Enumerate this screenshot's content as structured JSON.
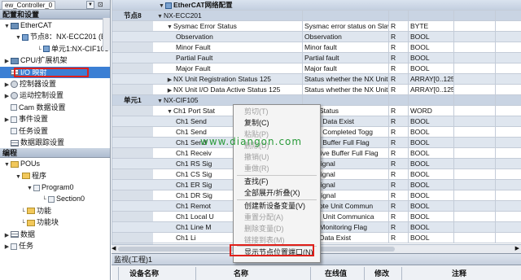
{
  "left": {
    "window_title": "ew_Controller_0",
    "section_config": "配置和设置",
    "section_program": "编程",
    "tree": [
      {
        "label": "EtherCAT"
      },
      {
        "label": "节点8：NX-ECC201 (E"
      },
      {
        "label": "单元1:NX-CIF105"
      },
      {
        "label": "CPU/扩展机架"
      },
      {
        "label": "I/O 映射"
      },
      {
        "label": "控制器设置"
      },
      {
        "label": "运动控制设置"
      },
      {
        "label": "Cam 数据设置"
      },
      {
        "label": "事件设置"
      },
      {
        "label": "任务设置"
      },
      {
        "label": "数据跟踪设置"
      }
    ],
    "program_tree": [
      {
        "label": "POUs"
      },
      {
        "label": "程序"
      },
      {
        "label": "Program0"
      },
      {
        "label": "Section0"
      },
      {
        "label": "功能"
      },
      {
        "label": "功能块"
      },
      {
        "label": "数据"
      },
      {
        "label": "任务"
      }
    ]
  },
  "grid": {
    "header": "EtherCAT网络配置",
    "rows": [
      {
        "node": "节点8",
        "name": "NX-ECC201",
        "desc": "",
        "rw": "",
        "type": ""
      },
      {
        "node": "",
        "name": "Sysmac Error Status",
        "desc": "Sysmac error status on Slav",
        "rw": "R",
        "type": "BYTE"
      },
      {
        "node": "",
        "name": "Observation",
        "desc": "Observation",
        "rw": "R",
        "type": "BOOL"
      },
      {
        "node": "",
        "name": "Minor Fault",
        "desc": "Minor fault",
        "rw": "R",
        "type": "BOOL"
      },
      {
        "node": "",
        "name": "Partial Fault",
        "desc": "Partial fault",
        "rw": "R",
        "type": "BOOL"
      },
      {
        "node": "",
        "name": "Major Fault",
        "desc": "Major fault",
        "rw": "R",
        "type": "BOOL"
      },
      {
        "node": "",
        "name": "NX Unit Registration Status 125",
        "desc": "Status whether the NX Unit",
        "rw": "R",
        "type": "ARRAY[0..125"
      },
      {
        "node": "",
        "name": "NX Unit I/O Data Active Status 125",
        "desc": "Status whether the NX Unit",
        "rw": "R",
        "type": "ARRAY[0..125"
      },
      {
        "node": "单元1",
        "name": "NX-CIF105",
        "desc": "",
        "rw": "",
        "type": ""
      },
      {
        "node": "",
        "name": "Ch1 Port Stat",
        "desc": "Port Status",
        "rw": "R",
        "type": "WORD"
      },
      {
        "node": "",
        "name": "Ch1 Send",
        "desc": "Send Data Exist",
        "rw": "R",
        "type": "BOOL"
      },
      {
        "node": "",
        "name": "Ch1 Send",
        "desc": "Send Completed Togg",
        "rw": "R",
        "type": "BOOL"
      },
      {
        "node": "",
        "name": "Ch1 Send",
        "desc": "Send Buffer Full Flag",
        "rw": "R",
        "type": "BOOL"
      },
      {
        "node": "",
        "name": "Ch1 Receiv",
        "desc": "Receive Buffer Full Flag",
        "rw": "R",
        "type": "BOOL"
      },
      {
        "node": "",
        "name": "Ch1 RS Sig",
        "desc": "RS Signal",
        "rw": "R",
        "type": "BOOL"
      },
      {
        "node": "",
        "name": "Ch1 CS Sig",
        "desc": "CS Signal",
        "rw": "R",
        "type": "BOOL"
      },
      {
        "node": "",
        "name": "Ch1 ER Sig",
        "desc": "ER Signal",
        "rw": "R",
        "type": "BOOL"
      },
      {
        "node": "",
        "name": "Ch1 DR Sig",
        "desc": "DR Signal",
        "rw": "R",
        "type": "BOOL"
      },
      {
        "node": "",
        "name": "Ch1 Remot",
        "desc": "Remote Unit Commun",
        "rw": "R",
        "type": "BOOL"
      },
      {
        "node": "",
        "name": "Ch1 Local U",
        "desc": "Local Unit Communica",
        "rw": "R",
        "type": "BOOL"
      },
      {
        "node": "",
        "name": "Ch1 Line M",
        "desc": "Line Monitoring Flag",
        "rw": "R",
        "type": "BOOL"
      },
      {
        "node": "",
        "name": "Ch1 Li",
        "desc": "Line Data Exist",
        "rw": "R",
        "type": "BOOL"
      }
    ]
  },
  "context_menu": {
    "items": [
      {
        "label": "剪切(T)",
        "enabled": false
      },
      {
        "label": "复制(C)",
        "enabled": true
      },
      {
        "label": "粘贴(P)",
        "enabled": false
      },
      {
        "label": "删除(D)",
        "enabled": false
      },
      {
        "label": "撤销(U)",
        "enabled": false
      },
      {
        "label": "重做(R)",
        "enabled": false
      },
      {
        "label": "查找(F)",
        "enabled": true
      },
      {
        "label": "全部展开/折叠(X)",
        "enabled": true
      },
      {
        "label": "创建新设备变量(V)",
        "enabled": true
      },
      {
        "label": "重置分配(A)",
        "enabled": false
      },
      {
        "label": "删除变量(D)",
        "enabled": false
      },
      {
        "label": "链接到表(M)",
        "enabled": false
      },
      {
        "label": "显示节点位置端口(N)",
        "enabled": true
      }
    ]
  },
  "watch": {
    "title": "监视(工程)1",
    "columns": [
      "设备名称",
      "名称",
      "在线值",
      "修改",
      "注释"
    ]
  },
  "watermark": "www.diangon.com"
}
